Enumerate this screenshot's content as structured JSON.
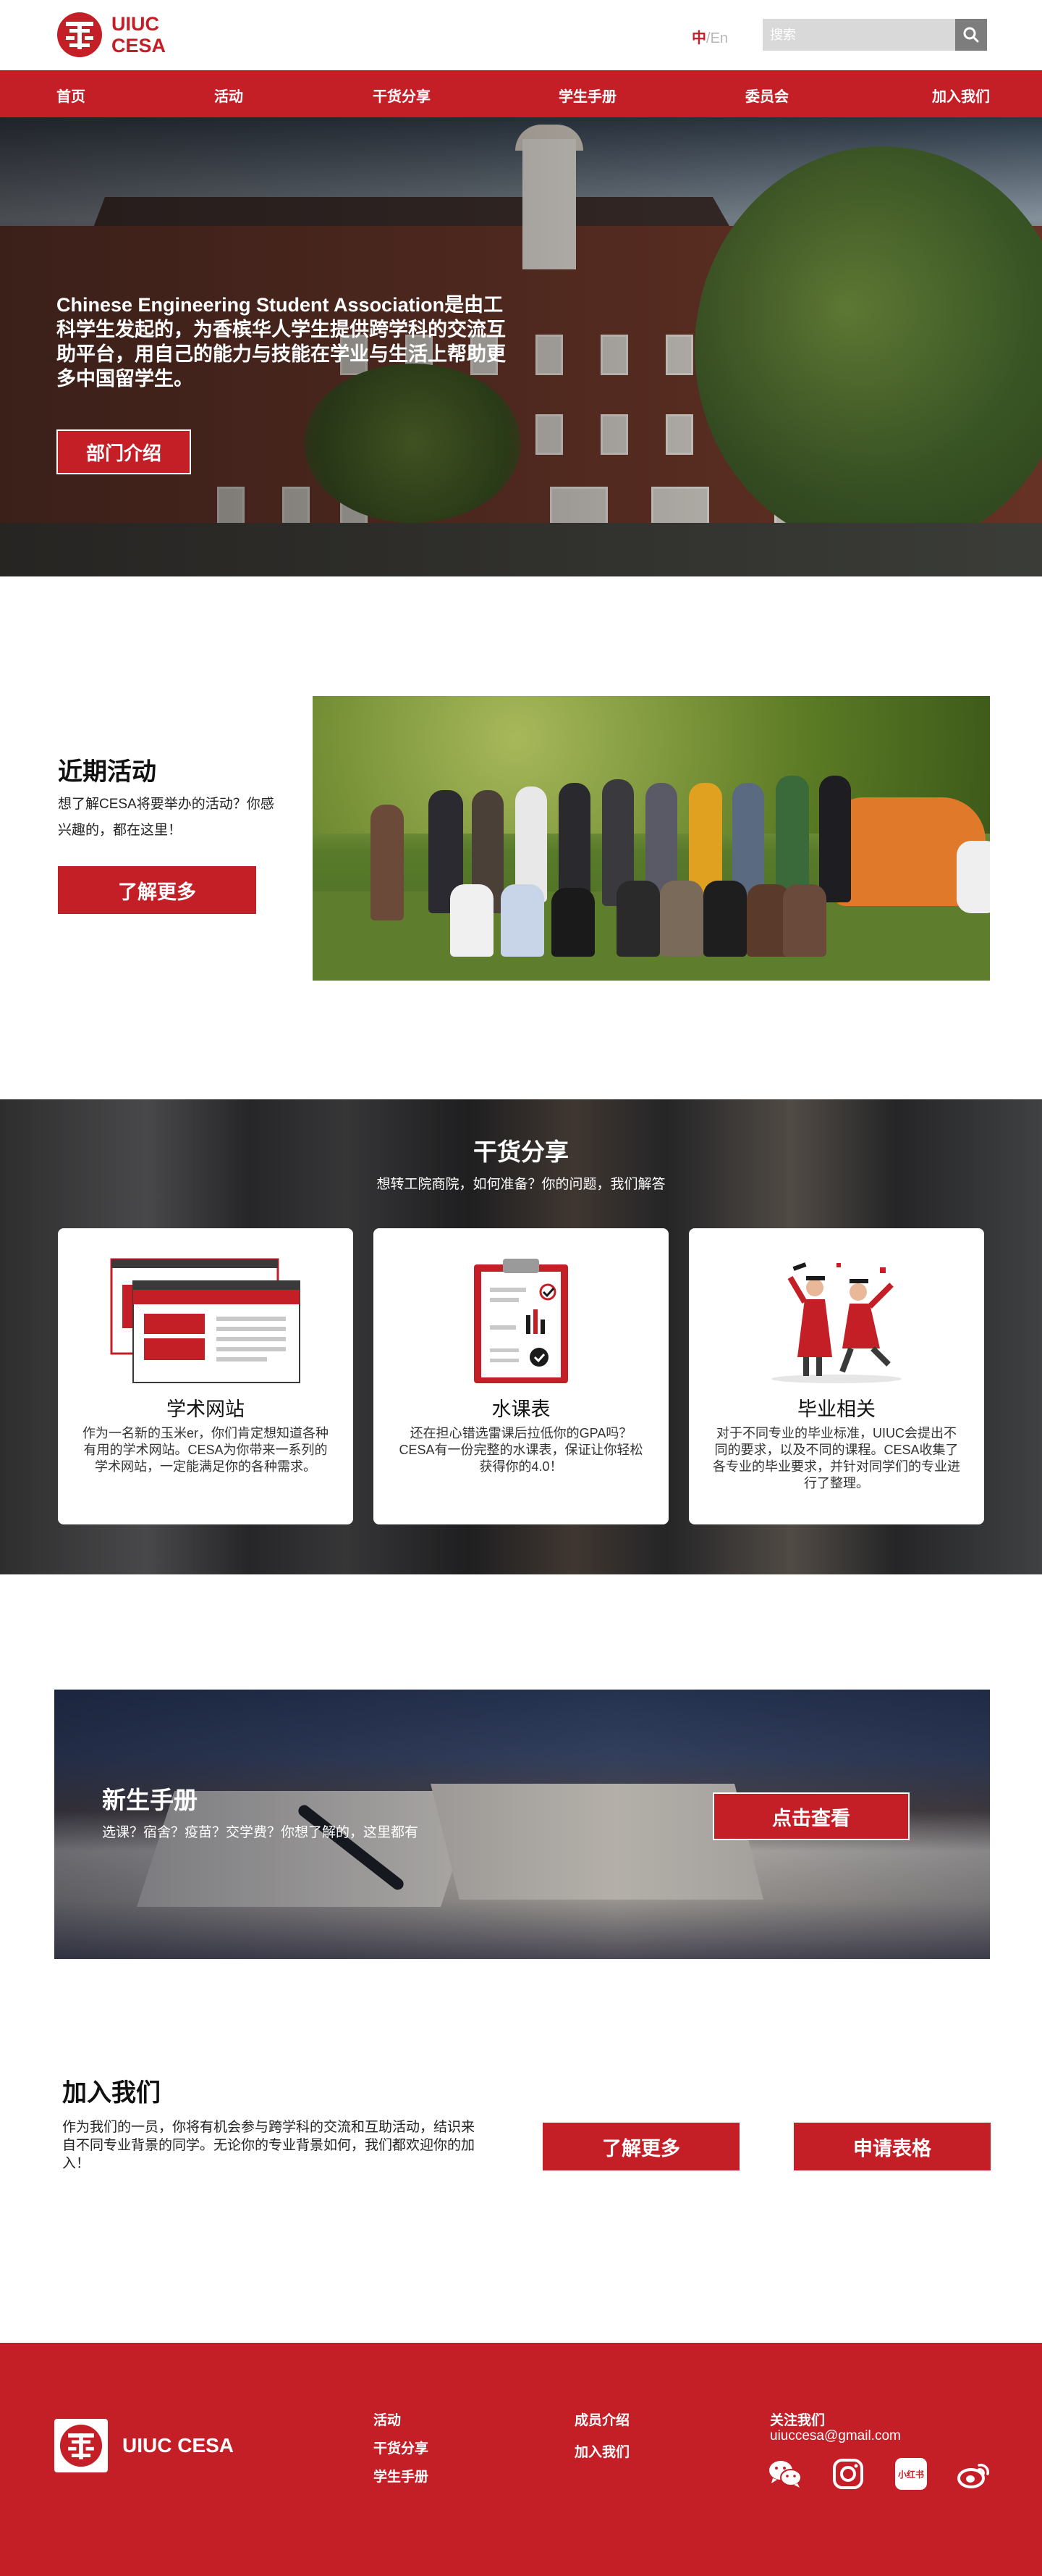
{
  "header": {
    "logo_line1": "UIUC",
    "logo_line2": "CESA",
    "lang_zh": "中",
    "lang_sep": "/",
    "lang_en": "En",
    "search_placeholder": "搜索"
  },
  "nav": [
    "首页",
    "活动",
    "干货分享",
    "学生手册",
    "委员会",
    "加入我们"
  ],
  "hero": {
    "text": "Chinese Engineering Student Association是由工科学生发起的，为香槟华人学生提供跨学科的交流互助平台，用自己的能力与技能在学业与生活上帮助更多中国留学生。",
    "button": "部门介绍"
  },
  "recent": {
    "title": "近期活动",
    "desc": "想了解CESA将要举办的活动？你感兴趣的，都在这里！",
    "button": "了解更多"
  },
  "dry": {
    "title": "干货分享",
    "subtitle": "想转工院商院，如何准备？你的问题，我们解答",
    "cards": [
      {
        "title": "学术网站",
        "desc": "作为一名新的玉米er，你们肯定想知道各种有用的学术网站。CESA为你带来一系列的学术网站，一定能满足你的各种需求。"
      },
      {
        "title": "水课表",
        "desc": "还在担心错选雷课后拉低你的GPA吗？CESA有一份完整的水课表，保证让你轻松获得你的4.0！"
      },
      {
        "title": "毕业相关",
        "desc": "对于不同专业的毕业标准，UIUC会提出不同的要求，以及不同的课程。CESA收集了各专业的毕业要求，并针对同学们的专业进行了整理。"
      }
    ]
  },
  "handbook": {
    "title": "新生手册",
    "subtitle": "选课？宿舍？疫苗？交学费？你想了解的，这里都有",
    "button": "点击查看"
  },
  "join": {
    "title": "加入我们",
    "desc": "作为我们的一员，你将有机会参与跨学科的交流和互助活动，结识来自不同专业背景的同学。无论你的专业背景如何，我们都欢迎你的加入！",
    "button_more": "了解更多",
    "button_apply": "申请表格"
  },
  "footer": {
    "logo_text": "UIUC CESA",
    "col1": [
      "活动",
      "干货分享",
      "学生手册"
    ],
    "col2": [
      "成员介绍",
      "加入我们"
    ],
    "follow": "关注我们",
    "email": "uiuccesa@gmail.com",
    "social_icons": [
      "wechat-icon",
      "instagram-icon",
      "xiaohongshu-icon",
      "weibo-icon"
    ],
    "xiaohongshu_label": "小红书"
  },
  "colors": {
    "brand_red": "#c41e27",
    "search_bg": "#d9d9d9",
    "search_btn": "#7d7d7d"
  }
}
